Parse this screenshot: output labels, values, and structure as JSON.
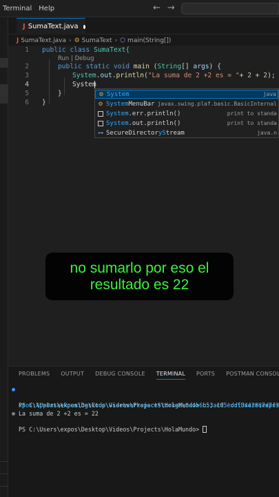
{
  "menu": [
    "Terminal",
    "Help"
  ],
  "nav": {
    "back_icon": "arrow-left-icon",
    "forward_icon": "arrow-right-icon"
  },
  "tab": {
    "label": "SumaText.java"
  },
  "breadcrumb": {
    "file": "SumaText.java",
    "class": "SumaText",
    "method": "main(String[])"
  },
  "editor": {
    "line_numbers": [
      "1",
      "2",
      "3",
      "4",
      "5",
      "6"
    ],
    "codelens": "Run | Debug",
    "line1": {
      "k1": "public",
      "k2": "class",
      "name": "SumaText{"
    },
    "line2": {
      "k1": "public",
      "k2": "static",
      "k3": "void",
      "fn": "main",
      "p1": " (",
      "ty": "String",
      "p2": "[] ",
      "var": "args",
      "p3": ") {"
    },
    "line3": {
      "a": "System",
      "b": ".",
      "c": "out",
      "d": ".",
      "fn": "println",
      "p1": "(",
      "str": "\"La suma de 2 +2 es = \"",
      "rest1": "+ ",
      "n1": "2",
      "rest2": " + ",
      "n2": "2",
      "rest3": ");"
    },
    "line4": {
      "typed": "System"
    },
    "line5": "}",
    "line6": "}"
  },
  "suggest": [
    {
      "hl": "System",
      "rest": "",
      "detail": "java",
      "icon": "class-icon"
    },
    {
      "hl": "System",
      "rest": "MenuBar",
      "detail": "javax.swing.plaf.basic.BasicInternal",
      "icon": "class-icon"
    },
    {
      "hl": "System",
      "rest": ".err.println()",
      "detail": "print to standa",
      "icon": "snippet-icon"
    },
    {
      "hl": "System",
      "rest": ".out.println()",
      "detail": "print to standa",
      "icon": "snippet-icon"
    },
    {
      "hl": "",
      "pre": "SecureDirector",
      "mid": "yS",
      "post": "tream",
      "detail": "java.n",
      "icon": "interface-icon"
    }
  ],
  "caption": {
    "line1": "no sumarlo por eso el",
    "line2": "resultado es 22"
  },
  "panel_tabs": [
    "PROBLEMS",
    "OUTPUT",
    "DEBUG CONSOLE",
    "TERMINAL",
    "PORTS",
    "POSTMAN CONSOLE"
  ],
  "terminal": {
    "l1_prompt": "PS C:\\Users\\expos\\Desktop\\Videos\\Projects\\HolaMundo> ",
    "l1_cmd": "c:; cd ",
    "l1_path": "'c:\\Users\\expos",
    "l2": "xpos\\AppData\\Roaming\\Code\\User\\workspaceStorage\\0e4b6b53a195eddf34438d7d7f38",
    "l3": "La suma de 2 +2 es = 22",
    "l4_prompt": "PS C:\\Users\\expos\\Desktop\\Videos\\Projects\\HolaMundo> "
  }
}
